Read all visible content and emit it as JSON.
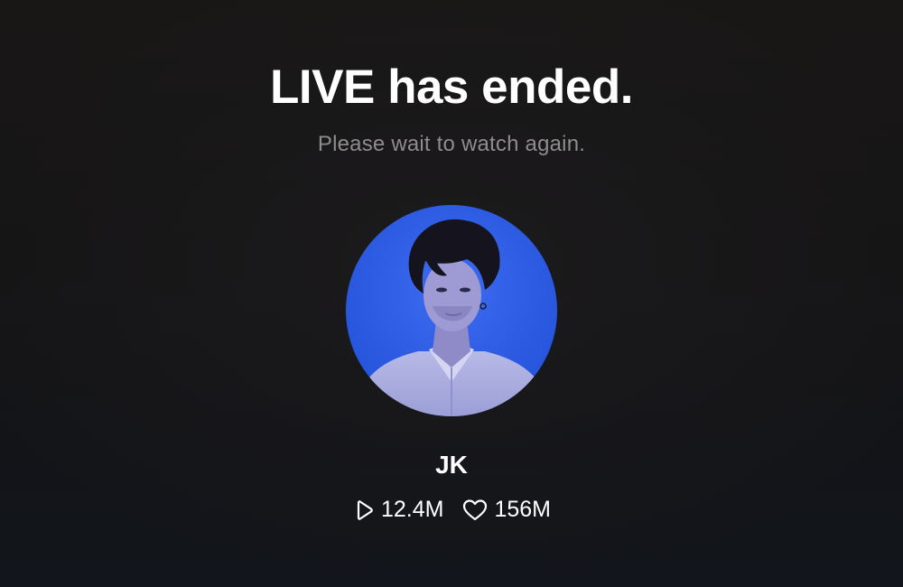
{
  "live_ended": {
    "title": "LIVE has ended.",
    "subtitle": "Please wait to watch again."
  },
  "profile": {
    "name": "JK",
    "avatar_icon": "profile-photo",
    "avatar_background": "#2f5ee8"
  },
  "stats": {
    "views": {
      "icon": "play-icon",
      "value": "12.4M"
    },
    "likes": {
      "icon": "heart-icon",
      "value": "156M"
    }
  },
  "colors": {
    "background": "#161516",
    "title": "#ffffff",
    "subtitle": "#8e8c8c"
  }
}
